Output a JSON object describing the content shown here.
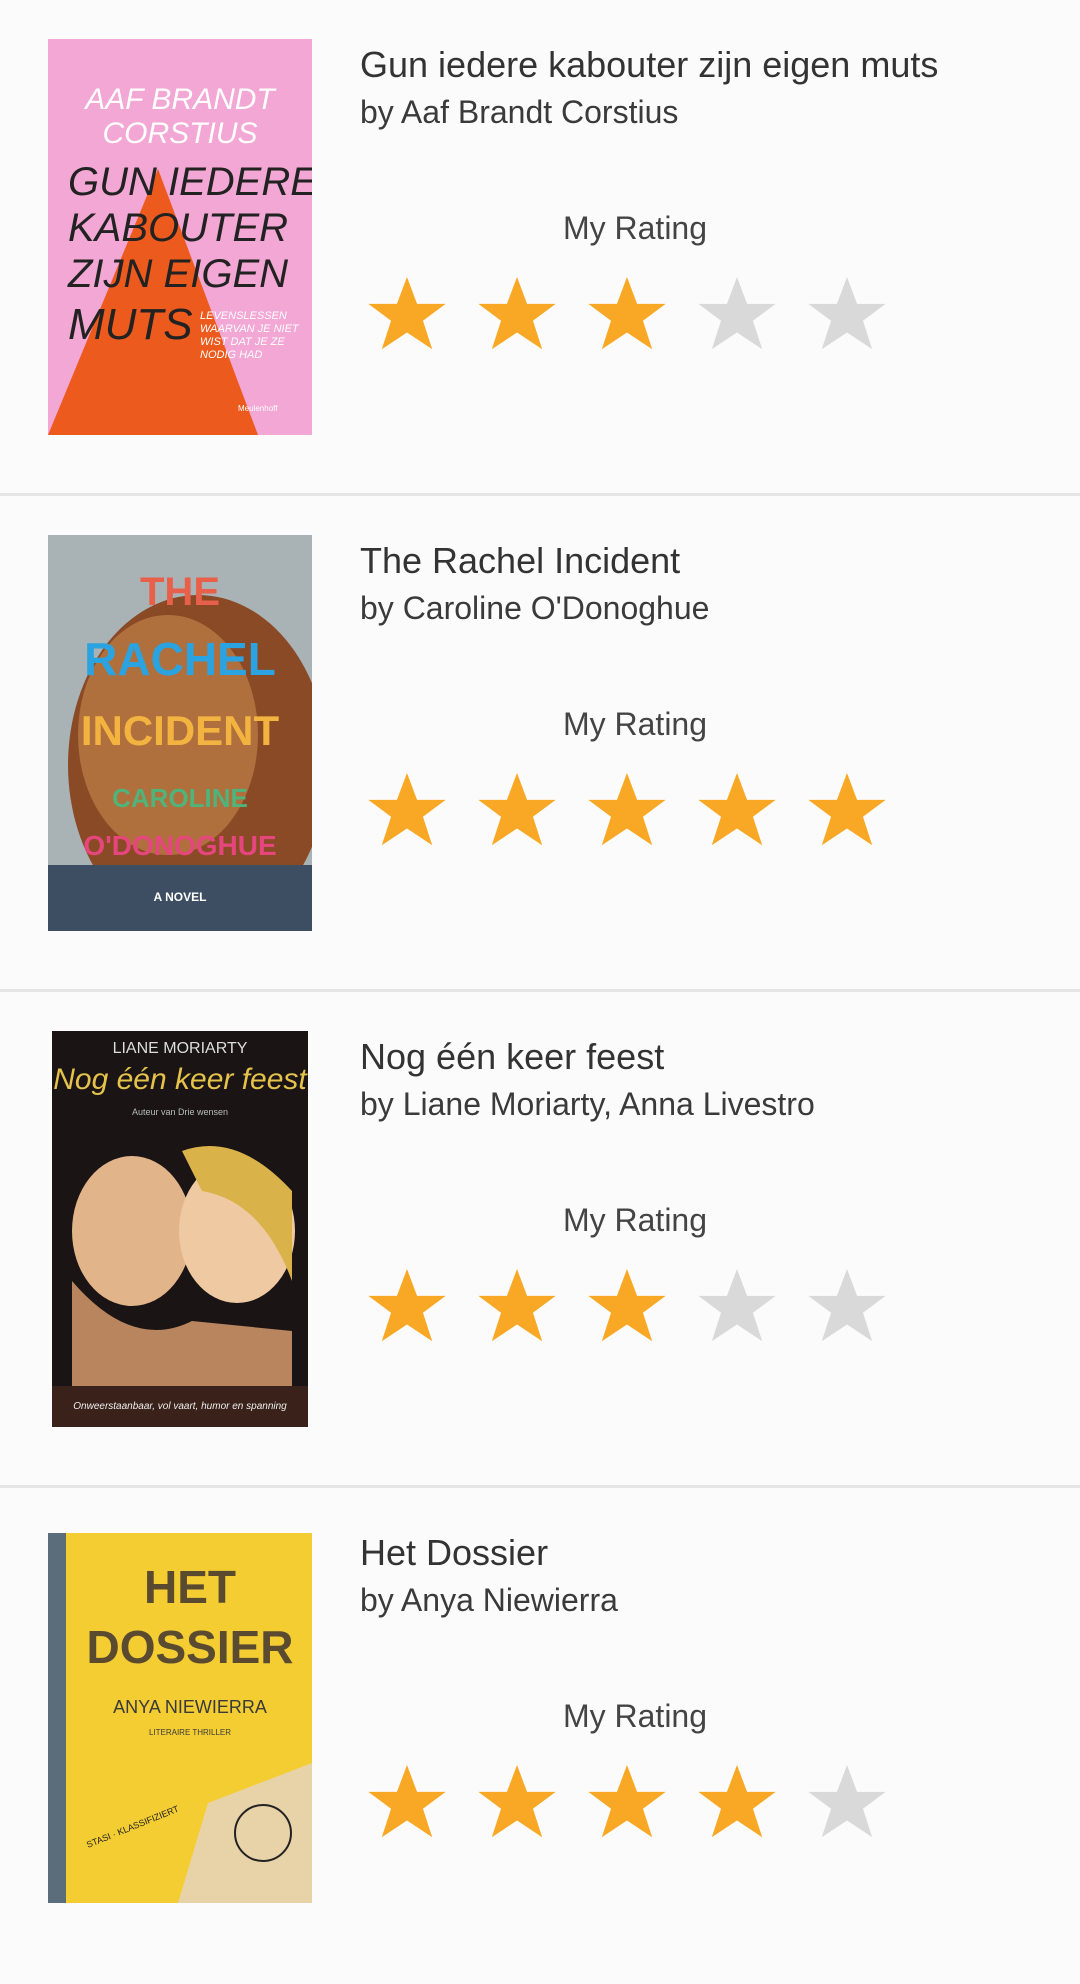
{
  "rating_label": "My Rating",
  "colors": {
    "star_filled": "#f9a825",
    "star_empty": "#d9d9d9",
    "divider": "#e6e6e6"
  },
  "books": [
    {
      "title": "Gun iedere kabouter zijn eigen muts",
      "author": "by Aaf Brandt Corstius",
      "rating": 3,
      "cover": {
        "author": "AAF BRANDT CORSTIUS",
        "author_line1": "AAF BRANDT",
        "author_line2": "CORSTIUS",
        "title_lines": [
          "GUN IEDERE",
          "KABOUTER",
          "ZIJN EIGEN",
          "MUTS"
        ],
        "tagline_lines": [
          "LEVENSLESSEN",
          "WAARVAN JE NIET",
          "WIST DAT JE ZE",
          "NODIG HAD"
        ],
        "publisher": "Meulenhoff"
      }
    },
    {
      "title": "The Rachel Incident",
      "author": "by Caroline O'Donoghue",
      "rating": 5,
      "cover": {
        "title_lines": [
          "THE",
          "RACHEL",
          "INCIDENT"
        ],
        "author_lines": [
          "CAROLINE",
          "O'DONOGHUE"
        ],
        "subtitle": "A NOVEL"
      }
    },
    {
      "title": "Nog één keer feest",
      "author": "by Liane Moriarty, Anna Livestro",
      "rating": 3,
      "cover": {
        "author": "LIANE MORIARTY",
        "title": "Nog één keer feest",
        "subtitle": "Auteur van Drie wensen",
        "tagline": "Onweerstaanbaar, vol vaart, humor en spanning"
      }
    },
    {
      "title": "Het Dossier",
      "author": "by Anya Niewierra",
      "rating": 4,
      "cover": {
        "title_lines": [
          "HET",
          "DOSSIER"
        ],
        "author": "ANYA NIEWIERRA",
        "genre": "LITERAIRE THRILLER",
        "stamp": "STASI · KLASSIFIZIERT"
      }
    }
  ]
}
